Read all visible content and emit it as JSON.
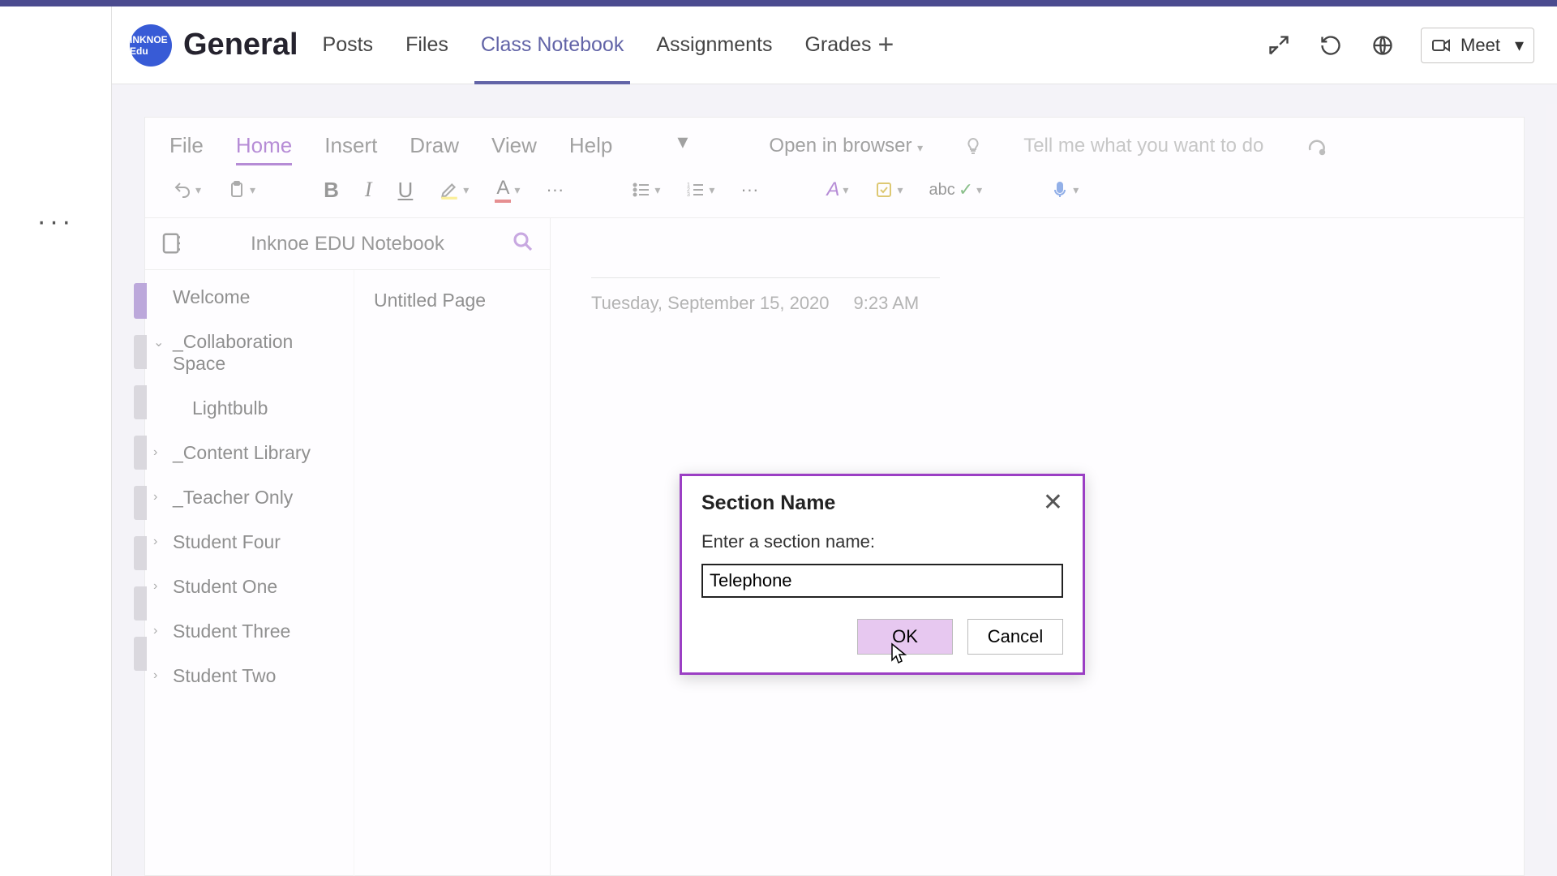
{
  "team": {
    "avatar_label": "INKNOE Edu"
  },
  "channel": {
    "title": "General",
    "tabs": [
      "Posts",
      "Files",
      "Class Notebook",
      "Assignments",
      "Grades"
    ],
    "active_tab_index": 2
  },
  "header_actions": {
    "meet_label": "Meet"
  },
  "ribbon": {
    "tabs": [
      "File",
      "Home",
      "Insert",
      "Draw",
      "View",
      "Help"
    ],
    "active_index": 1,
    "open_in_browser": "Open in browser",
    "tell_me_placeholder": "Tell me what you want to do"
  },
  "toolbar": {
    "bold": "B",
    "italic": "I",
    "underline": "U"
  },
  "notebook": {
    "name": "Inknoe EDU Notebook",
    "sections": [
      {
        "label": "Welcome",
        "expandable": false
      },
      {
        "label": "_Collaboration Space",
        "expandable": true,
        "expanded": true,
        "children": [
          {
            "label": "Lightbulb"
          }
        ]
      },
      {
        "label": "_Content Library",
        "expandable": true,
        "expanded": false
      },
      {
        "label": "_Teacher Only",
        "expandable": true,
        "expanded": false
      },
      {
        "label": "Student Four",
        "expandable": true,
        "expanded": false
      },
      {
        "label": "Student One",
        "expandable": true,
        "expanded": false
      },
      {
        "label": "Student Three",
        "expandable": true,
        "expanded": false
      },
      {
        "label": "Student Two",
        "expandable": true,
        "expanded": false
      }
    ],
    "pages": [
      "Untitled Page"
    ],
    "page_date": "Tuesday, September 15, 2020",
    "page_time": "9:23 AM"
  },
  "dialog": {
    "title": "Section Name",
    "prompt": "Enter a section name:",
    "value": "Telephone",
    "ok": "OK",
    "cancel": "Cancel"
  }
}
